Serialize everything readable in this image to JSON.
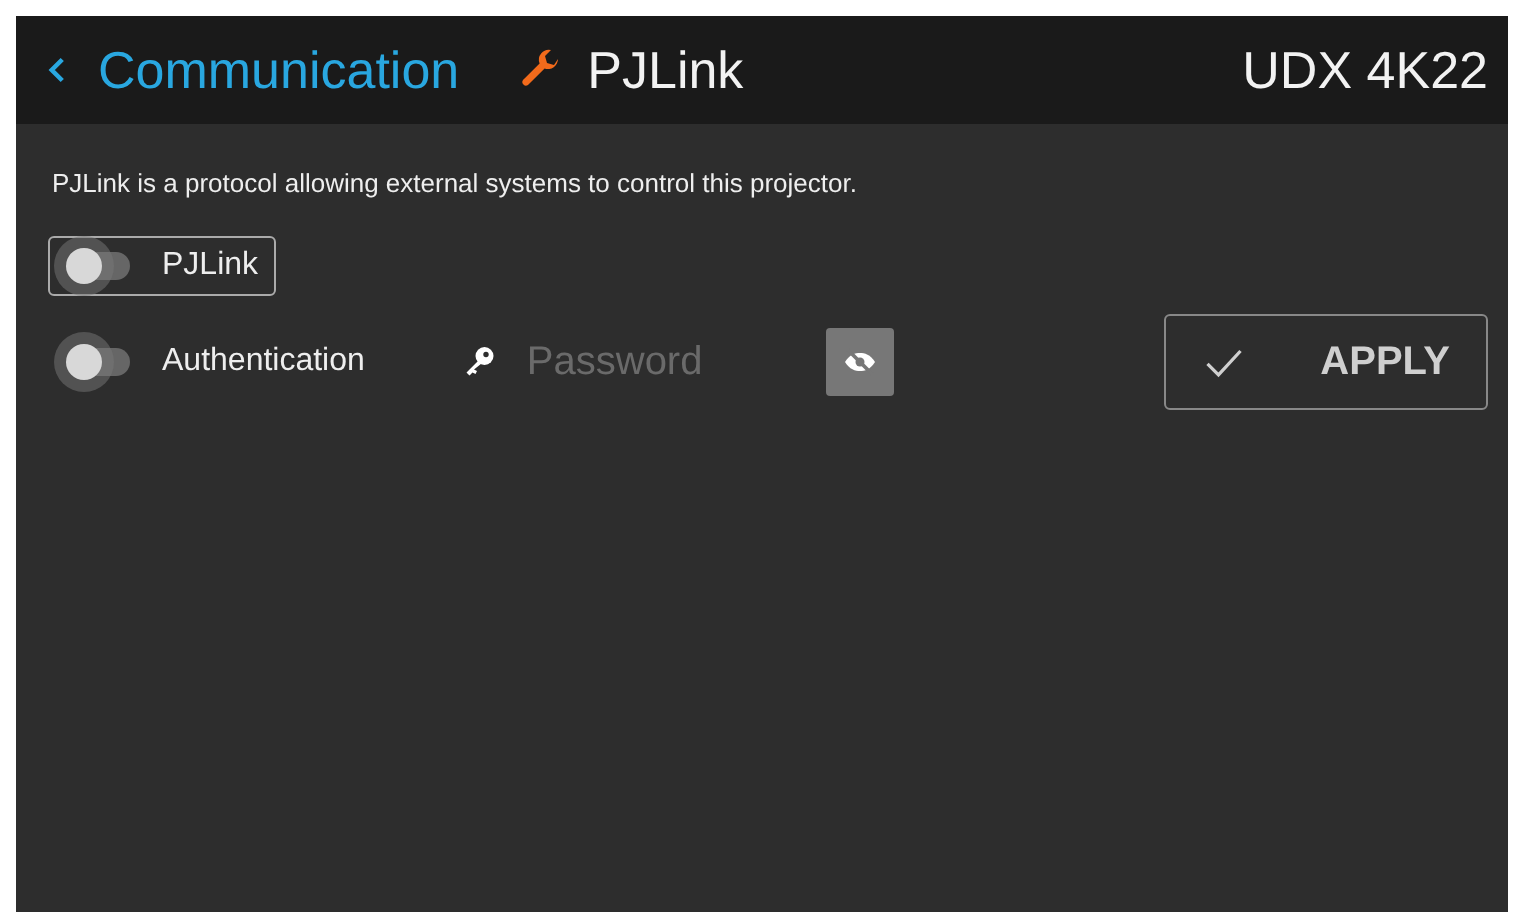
{
  "header": {
    "back_label": "Communication",
    "title": "PJLink",
    "device": "UDX 4K22"
  },
  "description": "PJLink is a protocol allowing external systems to control this projector.",
  "toggles": [
    {
      "label": "PJLink",
      "on": false,
      "focused": true
    },
    {
      "label": "Authentication",
      "on": false,
      "focused": false
    }
  ],
  "password": {
    "placeholder": "Password"
  },
  "apply_button": {
    "label": "APPLY"
  }
}
